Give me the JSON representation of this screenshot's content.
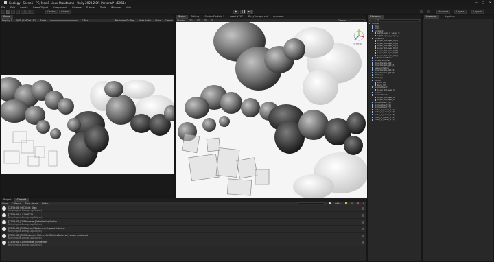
{
  "window": {
    "title": "Geology - Scene1 - PC, Mac & Linux Standalone - Unity 2020.2.0f1 Personal* <DX11>"
  },
  "menu": [
    "File",
    "Edit",
    "Assets",
    "GameObject",
    "Component",
    "Cinema",
    "Tutorial",
    "Tools",
    "Window",
    "Help"
  ],
  "toolbar": {
    "pivot_label": "Center",
    "space_label": "Global",
    "account_label": "Account",
    "layers_label": "Layers",
    "layout_label": "Layout"
  },
  "game_view": {
    "tab_label": "Game",
    "display_label": "Display 1",
    "resolution_label": "QHD (2560x1440)",
    "scale_label": "Scale",
    "scale_value": "0.38x",
    "toggles": [
      "Maximize On Play",
      "Mute Audio",
      "Stats",
      "Gizmos"
    ]
  },
  "scene_view": {
    "tabs": [
      "Scene",
      "Gallery",
      "CustomParticle 1",
      "Asset VFX?",
      "DirtyTransparent",
      "Animator"
    ],
    "shading_label": "Shaded",
    "mode_label": "2D",
    "gizmos_label": "Gizmos",
    "persp_label": "< Persp"
  },
  "hierarchy": {
    "tab_label": "Hierarchy",
    "create_label": "+",
    "search_placeholder": "All",
    "items": [
      {
        "label": "Scene1",
        "indent": 0
      },
      {
        "label": "Main",
        "indent": 1
      },
      {
        "label": "Light",
        "indent": 1
      },
      {
        "label": "Ambient",
        "indent": 1
      },
      {
        "label": "LightLayer_0_Layer_0",
        "indent": 2
      },
      {
        "label": "LightLayer_0_Layer_1",
        "indent": 2
      },
      {
        "label": "Invaders",
        "indent": 1
      },
      {
        "label": "Layer_0_Layer_0 (1)",
        "indent": 2
      },
      {
        "label": "Layer_0_Layer_0 (2)",
        "indent": 2
      },
      {
        "label": "Layer_0_Layer_0 (3)",
        "indent": 2
      },
      {
        "label": "Layer_0_Layer_0 (4)",
        "indent": 2
      },
      {
        "label": "Layer_0_Layer_0 (5)",
        "indent": 2
      },
      {
        "label": "Layer_0_Layer_0 (6)",
        "indent": 2
      },
      {
        "label": "Layer_0_Layer_0 (7)",
        "indent": 2
      },
      {
        "label": "DeformableBlobs",
        "indent": 1
      },
      {
        "label": "Global Volume",
        "indent": 1
      },
      {
        "label": "Directional Light",
        "indent": 1
      },
      {
        "label": "Directional Light (1)",
        "indent": 1
      },
      {
        "label": "SeaAnimation",
        "indent": 1
      },
      {
        "label": "Directional Light (2)",
        "indent": 1
      },
      {
        "label": "Directional Light (3)",
        "indent": 1
      },
      {
        "label": "Blob (1)",
        "indent": 1
      },
      {
        "label": "Blob (2)",
        "indent": 1
      },
      {
        "label": "Rocks",
        "indent": 1
      },
      {
        "label": "Rock (1)",
        "indent": 2
      },
      {
        "label": "Rock (2)",
        "indent": 2
      },
      {
        "label": "GameObject",
        "indent": 1
      },
      {
        "label": "Layer_0_Layer_1",
        "indent": 2
      },
      {
        "label": "Cursor",
        "indent": 1
      },
      {
        "label": "GameObject",
        "indent": 1
      },
      {
        "label": "Layer_0_Layer_0",
        "indent": 2
      },
      {
        "label": "Layer_0_Layer_1",
        "indent": 2
      },
      {
        "label": "GameObject (1)",
        "indent": 1
      },
      {
        "label": "GameObject (2)",
        "indent": 1
      },
      {
        "label": "GameObject (3)",
        "indent": 1
      },
      {
        "label": "Cube_0_Layer_0 (1)",
        "indent": 1
      },
      {
        "label": "Cube_0_Layer_0 (2)",
        "indent": 1
      },
      {
        "label": "Cube_0_Layer_0 (3)",
        "indent": 1
      },
      {
        "label": "Cube_0_Layer_0 (4)",
        "indent": 1
      },
      {
        "label": "Cube_0_Layer_0 (5)",
        "indent": 1
      }
    ]
  },
  "inspector": {
    "tabs": [
      "Inspector",
      "Lighting"
    ]
  },
  "console": {
    "tabs": [
      "Project",
      "Console"
    ],
    "buttons": [
      "Clear",
      "Collapse",
      "Error Pause",
      "Editor"
    ],
    "search_placeholder": "",
    "counts": {
      "logs": "999+",
      "warnings": "0",
      "errors": "0"
    },
    "messages": [
      {
        "line1": "[23:59:58] OSC Unit : Start",
        "line2": "UnityEngine.Debug:Log(Object)"
      },
      {
        "line1": "[23:59:58] 0.01568376",
        "line2": "UnityEngine.Debug:Log(Object)"
      },
      {
        "line1": "[23:59:58] [OVRManager] InitializeApplication",
        "line2": "UnityEngine.Debug:Log(Object)"
      },
      {
        "line1": "[23:59:58] [OVRNetworkTcpServer] Stopped listening",
        "line2": "UnityEngine.Debug:Log(Object)"
      },
      {
        "line1": "[23:59:58] [OVRSystemPerfMetrics.PerfMetricsTcpServer] server destroyed",
        "line2": "UnityEngine.Debug:Log(Object)"
      },
      {
        "line1": "[23:59:58] [OVRManager] OnDestroy",
        "line2": "UnityEngine.Debug:Log(Object)"
      }
    ]
  }
}
